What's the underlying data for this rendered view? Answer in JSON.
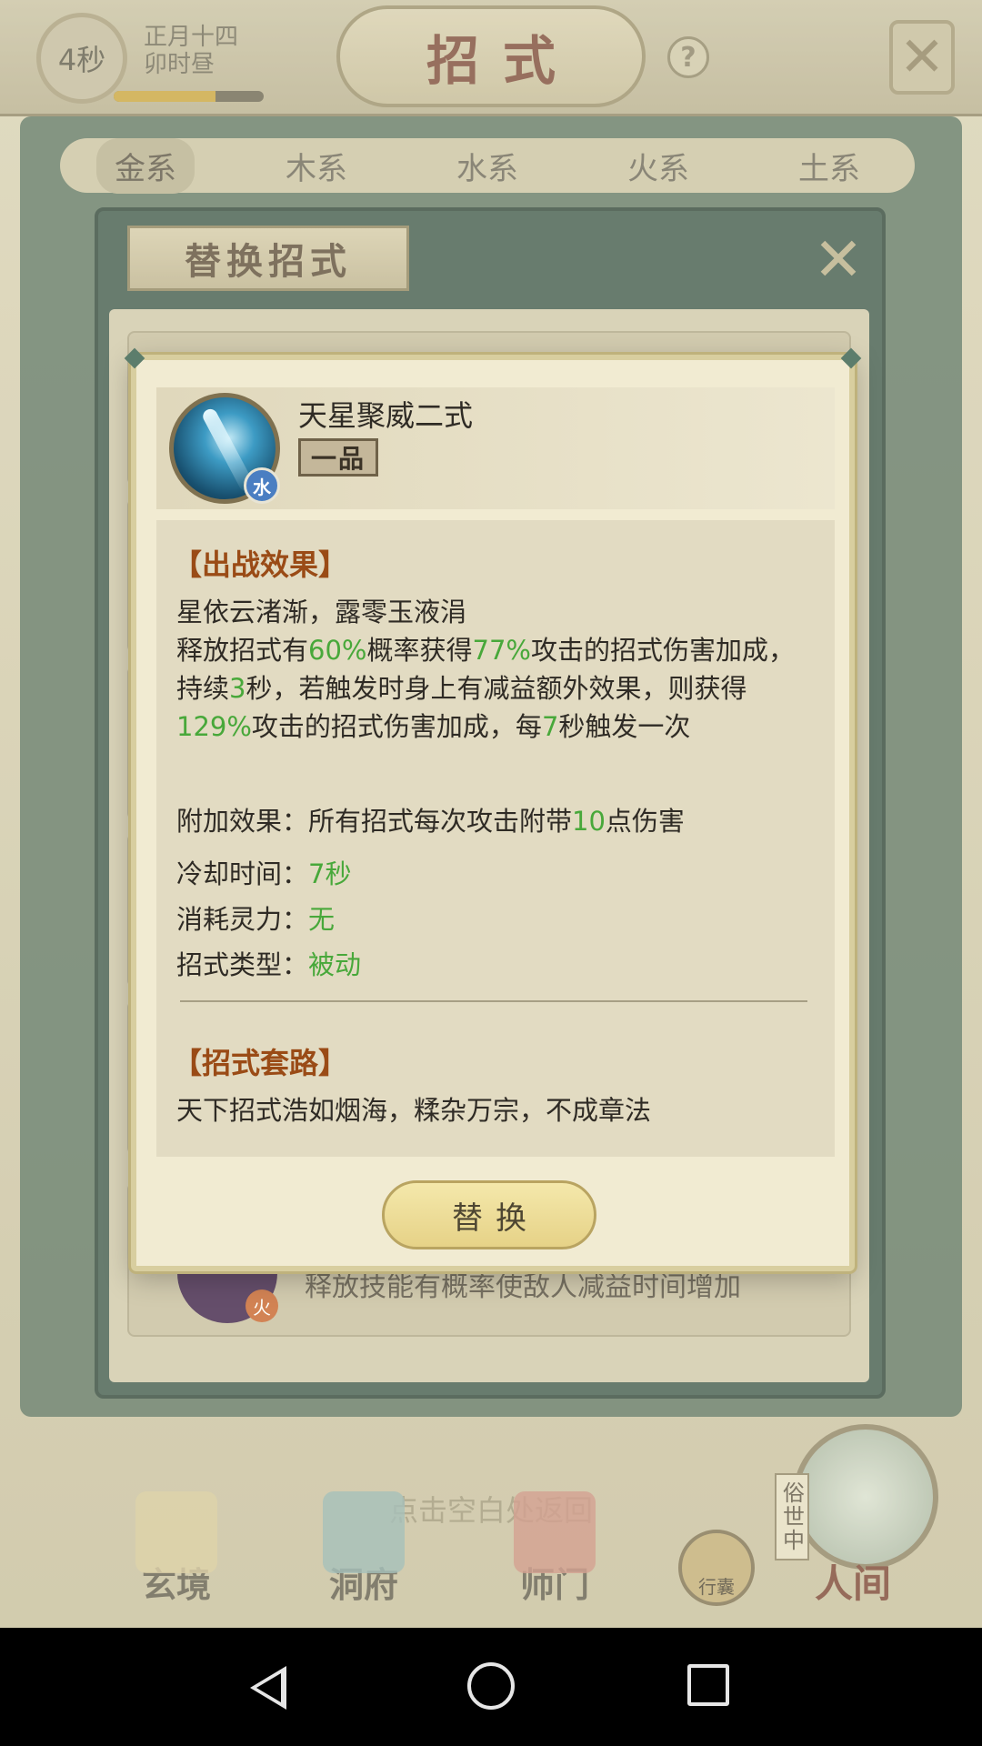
{
  "topbar": {
    "timer": "4秒",
    "date_line1": "正月十四",
    "date_line2": "卯时昼",
    "title": "招式",
    "time_progress": 0.68
  },
  "tabs": [
    "金系",
    "木系",
    "水系",
    "火系",
    "土系"
  ],
  "active_tab": "金系",
  "replace_panel": {
    "title": "替换招式",
    "behind_text": "释放技能有概率使敌人减益时间增加",
    "behind_element": "火"
  },
  "skill": {
    "name": "天星聚威二式",
    "grade": "一品",
    "element": "水",
    "battle_title": "【出战效果】",
    "battle_lines": [
      "星依云渚渐，露零玉液涓"
    ],
    "effect": {
      "p1": "释放招式有",
      "v1": "60%",
      "p2": "概率获得",
      "v2": "77%",
      "p3": "攻击的招式伤害加成，持续",
      "v3": "3",
      "p4": "秒，若触发时身上有减益额外效果，则获得",
      "v4": "129%",
      "p5": "攻击的招式伤害加成，每",
      "v5": "7",
      "p6": "秒触发一次"
    },
    "extra_label": "附加效果：所有招式每次攻击附带",
    "extra_value": "10",
    "extra_suffix": "点伤害",
    "cooldown_label": "冷却时间：",
    "cooldown_value": "7秒",
    "cost_label": "消耗灵力：",
    "cost_value": "无",
    "type_label": "招式类型：",
    "type_value": "被动",
    "route_title": "【招式套路】",
    "route_text": "天下招式浩如烟海，糅杂万宗，不成章法"
  },
  "replace_button": "替换",
  "hint": "点击空白处返回",
  "bottom_nav": [
    "玄境",
    "洞府",
    "师门"
  ],
  "bag_label": "行囊",
  "scene_tag": "俗世中",
  "scene_label": "人间",
  "colors": {
    "highlight_green": "#48a83a",
    "section_title": "#9a4b16",
    "dialog_bg": "#f1ebd2"
  }
}
